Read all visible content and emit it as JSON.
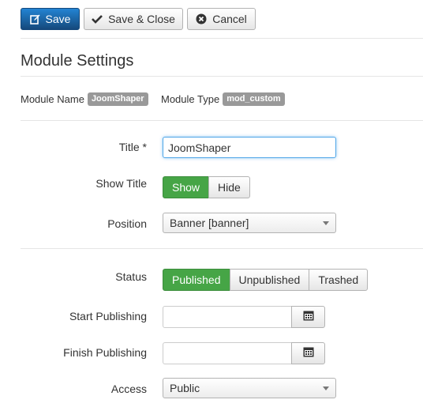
{
  "toolbar": {
    "save_label": "Save",
    "save_close_label": "Save & Close",
    "cancel_label": "Cancel"
  },
  "page_title": "Module Settings",
  "module_info": {
    "name_label": "Module Name",
    "name_value": "JoomShaper",
    "type_label": "Module Type",
    "type_value": "mod_custom"
  },
  "fields": {
    "title": {
      "label": "Title *",
      "value": "JoomShaper"
    },
    "show_title": {
      "label": "Show Title",
      "options": [
        "Show",
        "Hide"
      ],
      "selected": "Show"
    },
    "position": {
      "label": "Position",
      "selected": "Banner [banner]"
    },
    "status": {
      "label": "Status",
      "options": [
        "Published",
        "Unpublished",
        "Trashed"
      ],
      "selected": "Published"
    },
    "start_publishing": {
      "label": "Start Publishing",
      "value": ""
    },
    "finish_publishing": {
      "label": "Finish Publishing",
      "value": ""
    },
    "access": {
      "label": "Access",
      "selected": "Public"
    }
  },
  "colors": {
    "primary": "#2384d3",
    "success": "#46a546",
    "badge": "#999999",
    "focus": "#51a7e8"
  },
  "icons": {
    "save": "edit-icon",
    "save_close": "checkmark-icon",
    "cancel": "cancel-circle-icon",
    "calendar": "calendar-icon",
    "select": "chevron-down-icon"
  }
}
